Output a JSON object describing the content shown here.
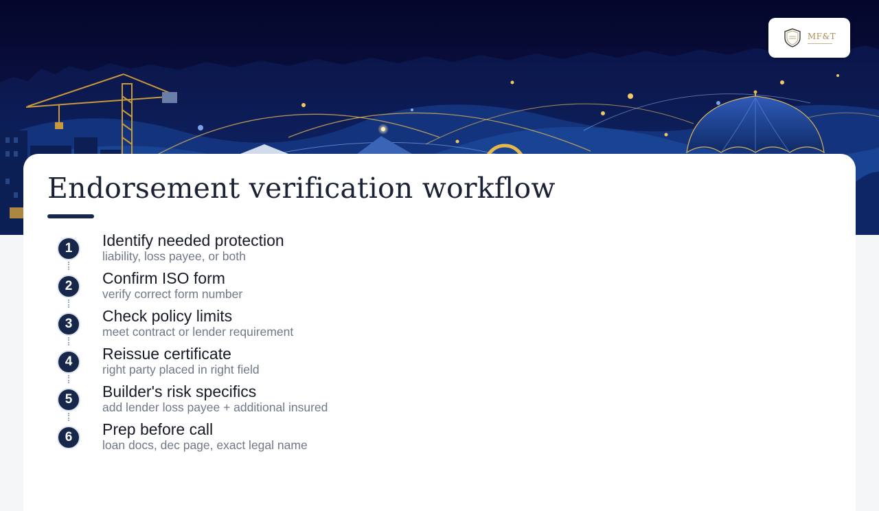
{
  "header": {
    "logo_text": "MF&T"
  },
  "slide": {
    "title": "Endorsement verification workflow"
  },
  "steps": [
    {
      "number": "1",
      "title": "Identify needed protection",
      "subtitle": "liability, loss payee, or both"
    },
    {
      "number": "2",
      "title": "Confirm ISO form",
      "subtitle": "verify correct form number"
    },
    {
      "number": "3",
      "title": "Check policy limits",
      "subtitle": "meet contract or lender requirement"
    },
    {
      "number": "4",
      "title": "Reissue certificate",
      "subtitle": "right party placed in right field"
    },
    {
      "number": "5",
      "title": "Builder's risk specifics",
      "subtitle": "add lender loss payee + additional insured"
    },
    {
      "number": "6",
      "title": "Prep before call",
      "subtitle": "loan docs, dec page, exact legal name"
    }
  ],
  "colors": {
    "navy": "#16274a",
    "hero_dark": "#06082a",
    "hero_blue": "#1b3a7a",
    "accent_gold": "#e8b84a"
  }
}
